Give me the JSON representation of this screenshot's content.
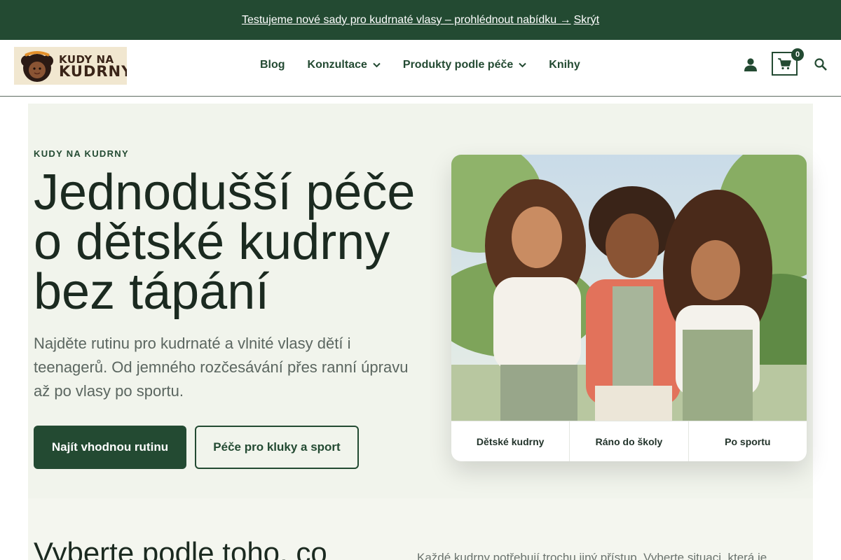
{
  "announcement": {
    "text": "Testujeme nové sady pro kudrnaté vlasy – prohlédnout nabídku →",
    "dismiss": "Skrýt"
  },
  "logo": {
    "line1": "KUDY NA",
    "line2": "KUDRNY"
  },
  "nav": {
    "items": [
      {
        "label": "Blog",
        "has_dropdown": false
      },
      {
        "label": "Konzultace",
        "has_dropdown": true
      },
      {
        "label": "Produkty podle péče",
        "has_dropdown": true
      },
      {
        "label": "Knihy",
        "has_dropdown": false
      }
    ]
  },
  "header_icons": {
    "account": "user-icon",
    "cart": "cart-icon",
    "cart_count": "0",
    "search": "search-icon"
  },
  "hero": {
    "eyebrow": "KUDY NA KUDRNY",
    "title": "Jednodušší péče o dětské kudrny bez tápání",
    "subtitle": "Najděte rutinu pro kudrnaté a vlnité vlasy dětí i teenagerů. Od jemného rozčesávání přes ranní úpravu až po vlasy po sportu.",
    "primary_button": "Najít vhodnou rutinu",
    "secondary_button": "Péče pro kluky a sport"
  },
  "card": {
    "tabs": [
      "Dětské kudrny",
      "Ráno do školy",
      "Po sportu"
    ]
  },
  "section2": {
    "title": "Vyberte podle toho, co",
    "text": "Každé kudrny potřebují trochu jiný přístup. Vyberte situaci, která je"
  },
  "colors": {
    "brand_green": "#234a32",
    "hero_background": "#f1f4ec",
    "text_dark": "#1b2a20",
    "text_muted": "#5b6660"
  }
}
